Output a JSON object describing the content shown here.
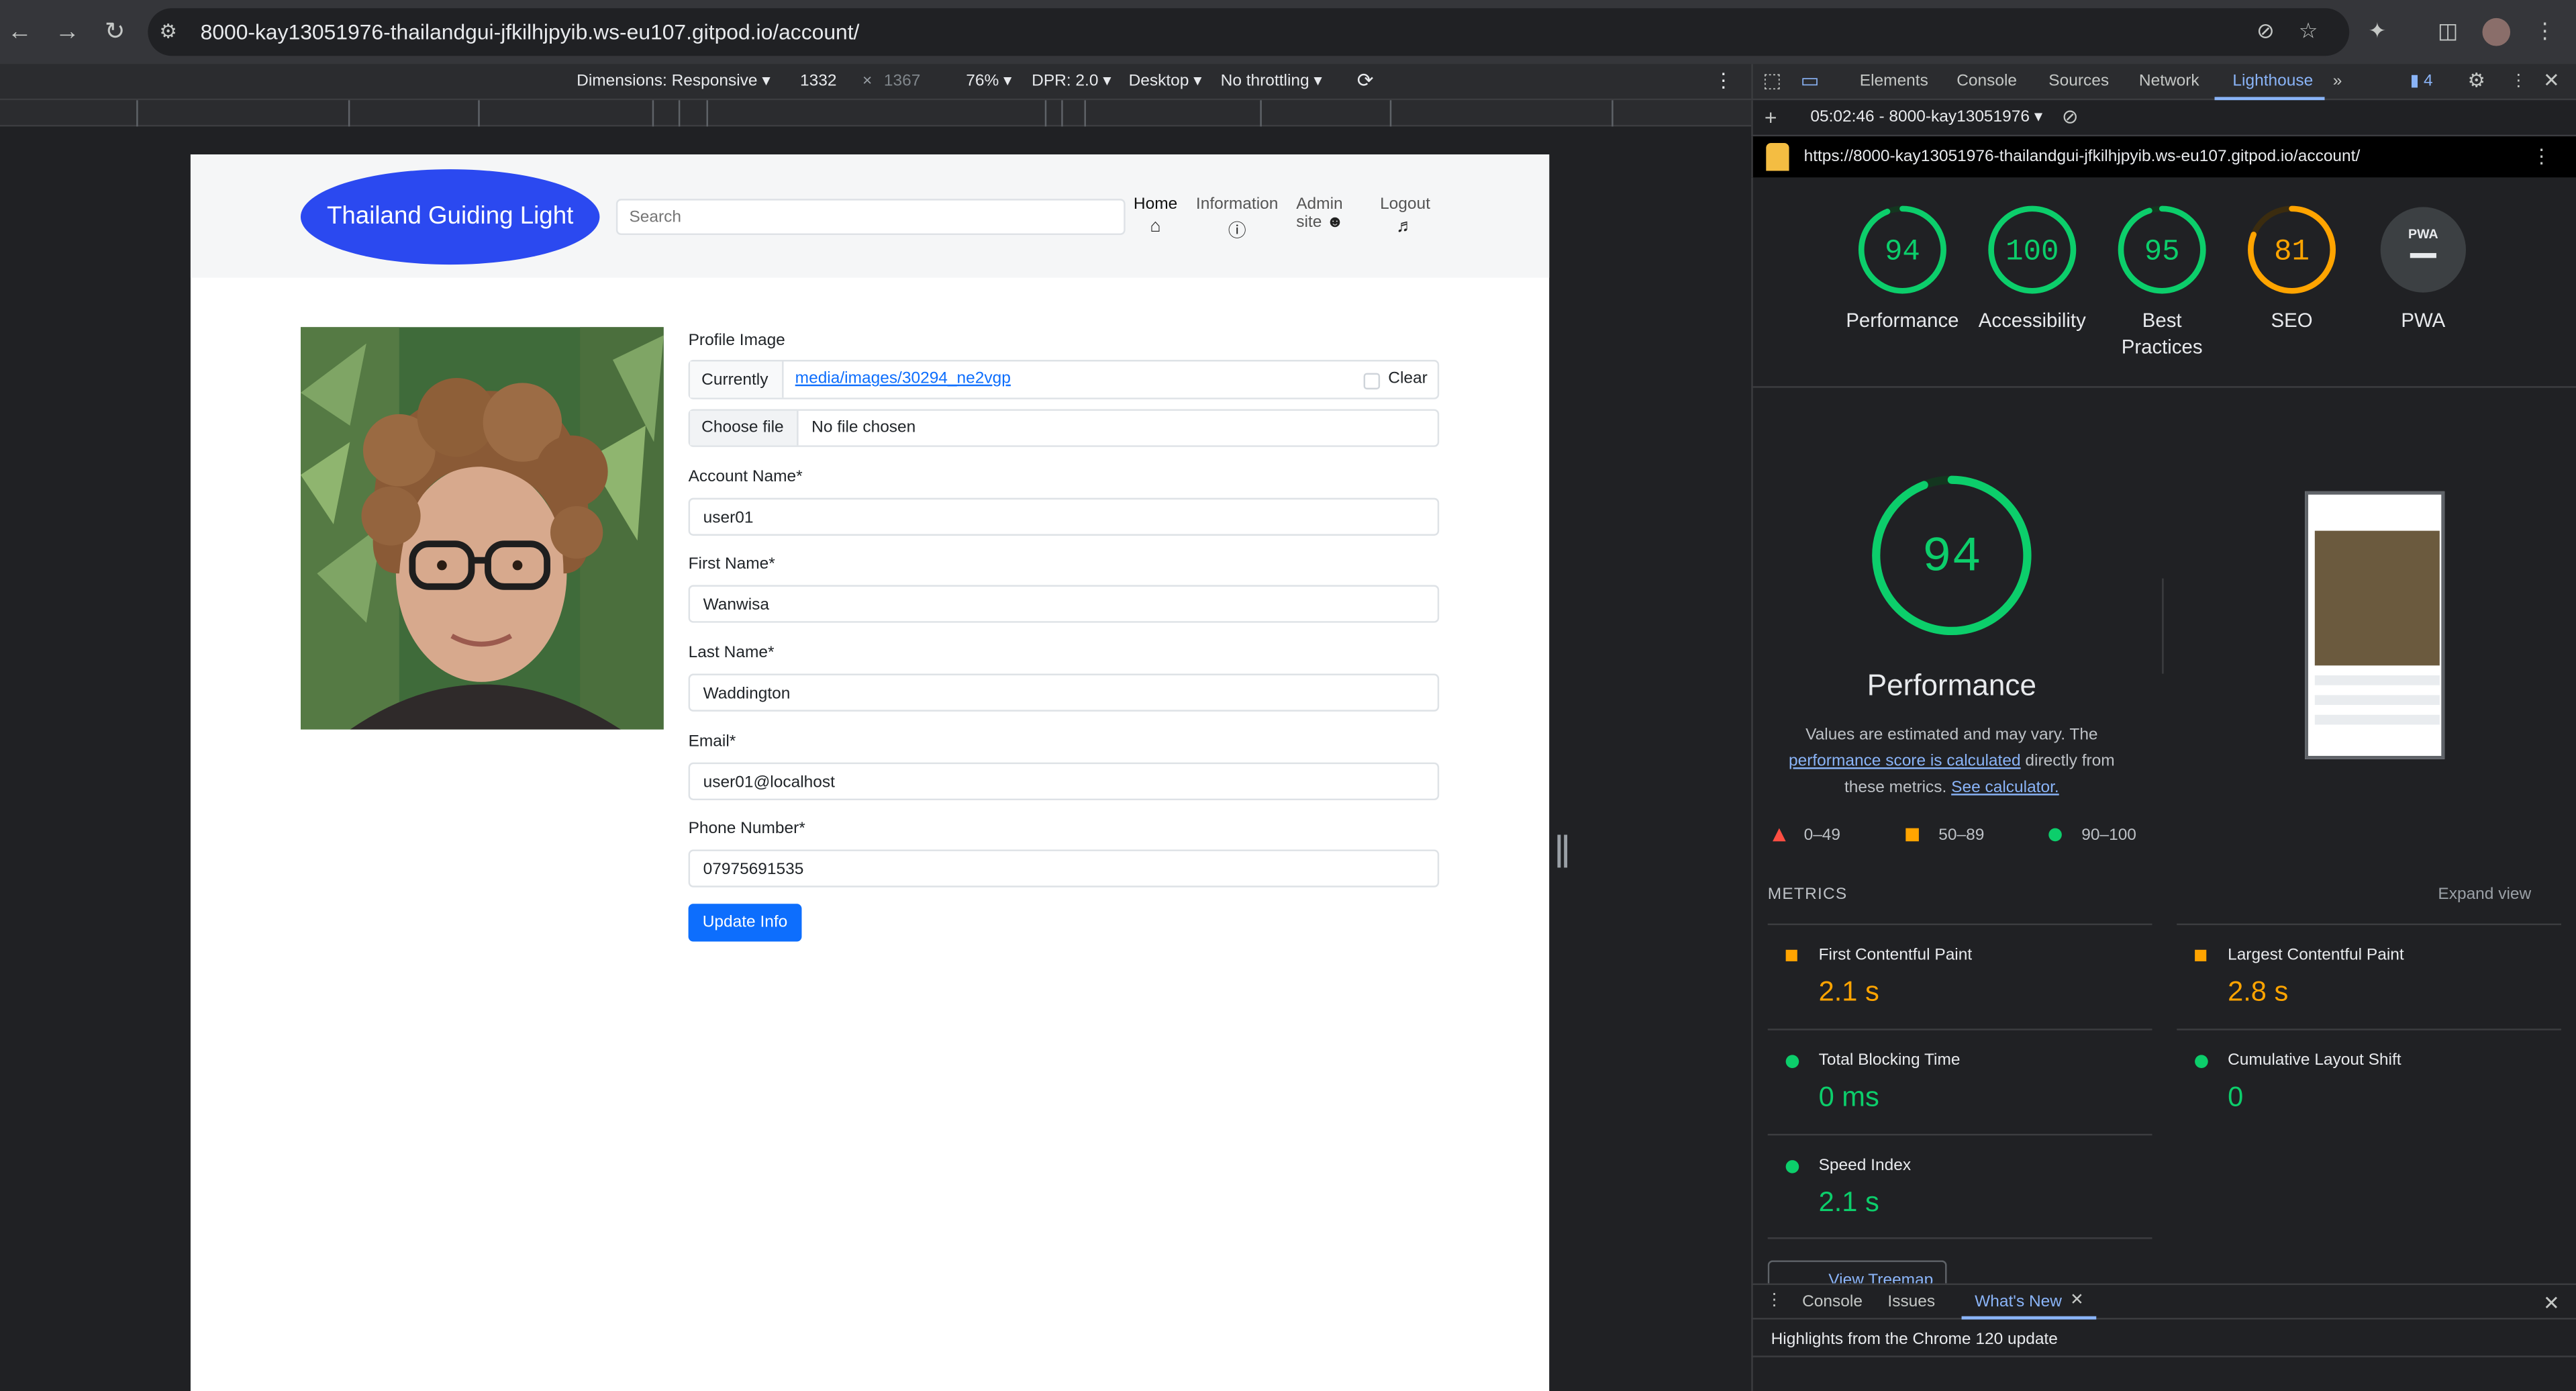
{
  "browser": {
    "url": "8000-kay13051976-thailandgui-jfkilhjpyib.ws-eu107.gitpod.io/account/"
  },
  "device_toolbar": {
    "dimensions": "Dimensions: Responsive",
    "width": "1332",
    "times": "×",
    "height": "1367",
    "zoom": "76%",
    "dpr": "DPR: 2.0",
    "device": "Desktop",
    "throttling": "No throttling"
  },
  "site": {
    "logo": "Thailand Guiding Light",
    "search_placeholder": "Search",
    "nav": [
      {
        "label": "Home",
        "label2": ""
      },
      {
        "label": "Information",
        "label2": ""
      },
      {
        "label": "Admin",
        "label2": "site"
      },
      {
        "label": "Logout",
        "label2": ""
      }
    ],
    "form": {
      "profile_image_label": "Profile Image",
      "currently_label": "Currently",
      "image_link": "media/images/30294_ne2vgp",
      "clear_label": "Clear",
      "choose_file_label": "Choose file",
      "no_file_label": "No file chosen",
      "account_name_label": "Account Name*",
      "account_name_value": "user01",
      "first_name_label": "First Name*",
      "first_name_value": "Wanwisa",
      "last_name_label": "Last Name*",
      "last_name_value": "Waddington",
      "email_label": "Email*",
      "email_value": "user01@localhost",
      "phone_label": "Phone Number*",
      "phone_value": "07975691535",
      "update_button": "Update Info"
    }
  },
  "devtools": {
    "tabs": [
      "Elements",
      "Console",
      "Sources",
      "Network",
      "Lighthouse"
    ],
    "active_tab": "Lighthouse",
    "issues_count": "4",
    "report_label": "05:02:46 - 8000-kay13051976",
    "report_url": "https://8000-kay13051976-thailandgui-jfkilhjpyib.ws-eu107.gitpod.io/account/",
    "scores": [
      {
        "value": "94",
        "score": 94,
        "label": "Performance",
        "label2": "",
        "color": "#0cce6b"
      },
      {
        "value": "100",
        "score": 100,
        "label": "Accessibility",
        "label2": "",
        "color": "#0cce6b"
      },
      {
        "value": "95",
        "score": 95,
        "label": "Best",
        "label2": "Practices",
        "color": "#0cce6b"
      },
      {
        "value": "81",
        "score": 81,
        "label": "SEO",
        "label2": "",
        "color": "#ffa400"
      },
      {
        "value": "",
        "score": 0,
        "label": "PWA",
        "label2": "",
        "color": "#9aa0a6",
        "badge": "PWA"
      }
    ],
    "big_score": {
      "value": "94",
      "score": 94,
      "label": "Performance"
    },
    "desc": {
      "part1": "Values are estimated and may vary. The",
      "link1": "performance score is calculated",
      "part2": "directly from",
      "part3": "these metrics.",
      "link2": "See calculator."
    },
    "legend": [
      {
        "range": "0–49",
        "color": "#ff4e42"
      },
      {
        "range": "50–89",
        "color": "#ffa400"
      },
      {
        "range": "90–100",
        "color": "#0cce6b"
      }
    ],
    "metrics_title": "METRICS",
    "expand_view": "Expand view",
    "metrics": [
      {
        "name": "First Contentful Paint",
        "value": "2.1 s",
        "status": "average",
        "color": "#ffa400"
      },
      {
        "name": "Largest Contentful Paint",
        "value": "2.8 s",
        "status": "average",
        "color": "#ffa400"
      },
      {
        "name": "Total Blocking Time",
        "value": "0 ms",
        "status": "pass",
        "color": "#0cce6b"
      },
      {
        "name": "Cumulative Layout Shift",
        "value": "0",
        "status": "pass",
        "color": "#0cce6b"
      },
      {
        "name": "Speed Index",
        "value": "2.1 s",
        "status": "pass",
        "color": "#0cce6b"
      }
    ],
    "treemap_button": "View Treemap",
    "drawer_tabs": [
      "Console",
      "Issues",
      "What's New"
    ],
    "drawer_active": "What's New",
    "drawer_text": "Highlights from the Chrome 120 update"
  }
}
